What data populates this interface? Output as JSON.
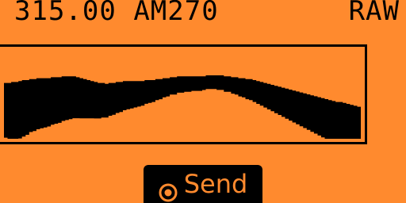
{
  "header": {
    "frequency": "315.00",
    "modulation": "AM270",
    "mode": "RAW"
  },
  "spectrum": {
    "fill_color": "#000000",
    "upper": [
      18,
      18,
      17,
      17,
      16,
      15,
      15,
      14,
      14,
      13,
      13,
      13,
      13,
      12,
      12,
      12,
      11,
      11,
      11,
      11,
      12,
      13,
      14,
      15,
      16,
      17,
      18,
      18,
      19,
      18,
      18,
      17,
      17,
      16,
      16,
      16,
      16,
      16,
      16,
      15,
      15,
      15,
      14,
      14,
      13,
      13,
      12,
      12,
      11,
      11,
      11,
      11,
      11,
      11,
      11,
      11,
      10,
      10,
      10,
      10,
      10,
      11,
      11,
      12,
      12,
      13,
      13,
      14,
      14,
      15,
      16,
      17,
      18,
      19,
      20,
      21,
      22,
      23,
      24,
      25,
      26,
      27,
      28,
      29,
      30,
      31,
      32,
      33,
      34,
      35,
      36,
      37,
      38,
      38,
      39,
      40,
      41,
      42,
      43,
      44
    ],
    "lower": [
      60,
      62,
      63,
      64,
      63,
      62,
      60,
      58,
      57,
      56,
      55,
      54,
      53,
      52,
      51,
      50,
      49,
      48,
      47,
      46,
      45,
      44,
      43,
      42,
      41,
      40,
      39,
      38,
      37,
      36,
      35,
      34,
      33,
      32,
      31,
      30,
      29,
      28,
      27,
      26,
      25,
      24,
      23,
      22,
      21,
      20,
      19,
      19,
      18,
      18,
      17,
      17,
      16,
      16,
      16,
      15,
      15,
      15,
      15,
      16,
      16,
      17,
      17,
      18,
      19,
      20,
      21,
      22,
      23,
      24,
      25,
      26,
      27,
      28,
      29,
      30,
      31,
      32,
      33,
      34,
      35,
      36,
      37,
      38,
      39,
      40,
      41,
      42,
      43,
      44,
      45,
      46,
      47,
      48,
      49,
      50,
      51,
      52,
      53,
      54
    ]
  },
  "send_button": {
    "label": "Send",
    "icon": "ok-circle-icon"
  }
}
